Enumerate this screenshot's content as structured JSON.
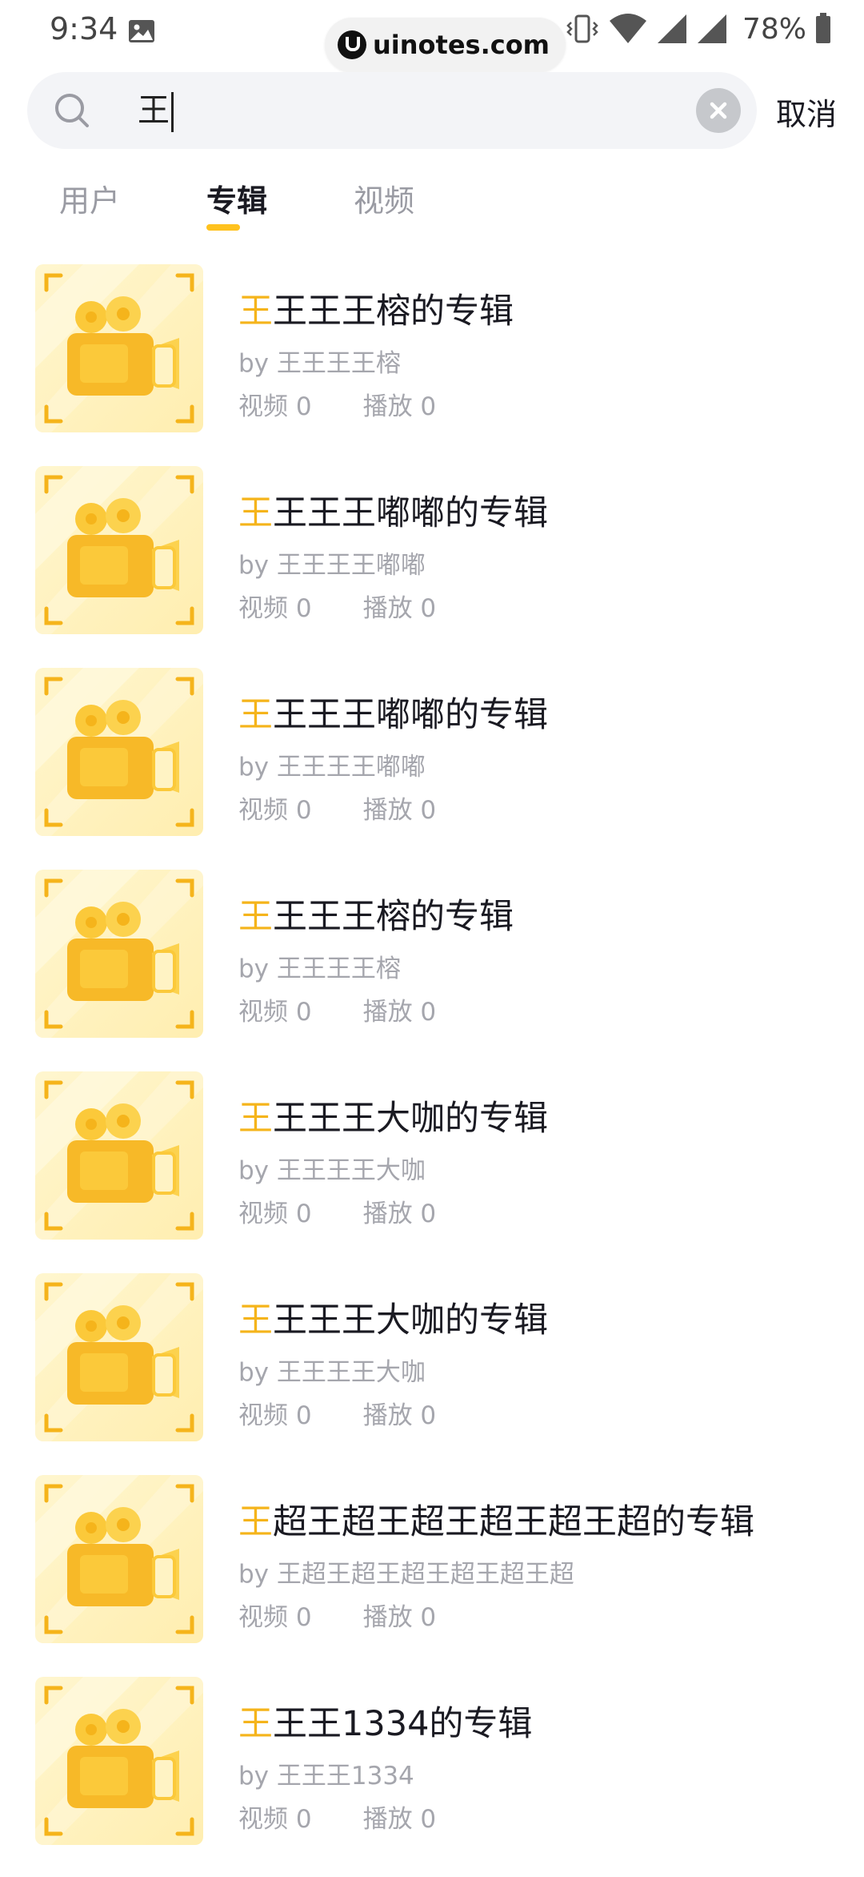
{
  "status_bar": {
    "time": "9:34",
    "watermark": "uinotes.com",
    "battery": "78%"
  },
  "search": {
    "query": "王",
    "cancel_label": "取消"
  },
  "tabs": [
    {
      "label": "用户",
      "active": false
    },
    {
      "label": "专辑",
      "active": true
    },
    {
      "label": "视频",
      "active": false
    }
  ],
  "album_list": {
    "items": [
      {
        "title_highlight": "王",
        "title_rest": "王王王榕的专辑",
        "author": "by 王王王王榕",
        "videos": "视频 0",
        "plays": "播放 0"
      },
      {
        "title_highlight": "王",
        "title_rest": "王王王嘟嘟的专辑",
        "author": "by 王王王王嘟嘟",
        "videos": "视频 0",
        "plays": "播放 0"
      },
      {
        "title_highlight": "王",
        "title_rest": "王王王嘟嘟的专辑",
        "author": "by 王王王王嘟嘟",
        "videos": "视频 0",
        "plays": "播放 0"
      },
      {
        "title_highlight": "王",
        "title_rest": "王王王榕的专辑",
        "author": "by 王王王王榕",
        "videos": "视频 0",
        "plays": "播放 0"
      },
      {
        "title_highlight": "王",
        "title_rest": "王王王大咖的专辑",
        "author": "by 王王王王大咖",
        "videos": "视频 0",
        "plays": "播放 0"
      },
      {
        "title_highlight": "王",
        "title_rest": "王王王大咖的专辑",
        "author": "by 王王王王大咖",
        "videos": "视频 0",
        "plays": "播放 0"
      },
      {
        "title_highlight": "王",
        "title_rest": "超王超王超王超王超王超的专辑",
        "author": "by 王超王超王超王超王超王超",
        "videos": "视频 0",
        "plays": "播放 0"
      },
      {
        "title_highlight": "王",
        "title_rest": "王王1334的专辑",
        "author": "by 王王王1334",
        "videos": "视频 0",
        "plays": "播放 0"
      }
    ]
  },
  "colors": {
    "accent": "#ffc21e",
    "highlight_text": "#f5b41b",
    "cover_bg": "#fff2b8",
    "cover_icon": "#fbc93a"
  },
  "icons": {
    "cover": "video-camera-icon",
    "search": "search-icon",
    "clear": "close-icon"
  }
}
